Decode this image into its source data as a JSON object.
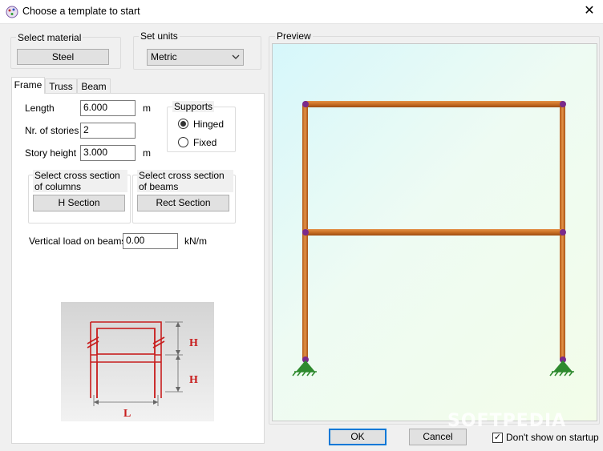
{
  "window": {
    "title": "Choose a template to start"
  },
  "material": {
    "label": "Select material",
    "button": "Steel"
  },
  "units": {
    "label": "Set units",
    "selected": "Metric"
  },
  "tabs": [
    {
      "label": "Frame",
      "active": true
    },
    {
      "label": "Truss",
      "active": false
    },
    {
      "label": "Beam",
      "active": false
    }
  ],
  "frame": {
    "length": {
      "label": "Length",
      "value": "6.000",
      "unit": "m"
    },
    "stories": {
      "label": "Nr. of stories",
      "value": "2"
    },
    "story_height": {
      "label": "Story height",
      "value": "3.000",
      "unit": "m"
    },
    "supports": {
      "label": "Supports",
      "options": [
        {
          "label": "Hinged",
          "selected": true
        },
        {
          "label": "Fixed",
          "selected": false
        }
      ]
    },
    "columns_section": {
      "label": "Select cross section of columns",
      "button": "H Section"
    },
    "beams_section": {
      "label": "Select cross section of beams",
      "button": "Rect Section"
    },
    "vertical_load": {
      "label": "Vertical load on beams",
      "value": "0.00",
      "unit": "kN/m"
    }
  },
  "diagram": {
    "dim_h1": "H",
    "dim_h2": "H",
    "dim_l": "L"
  },
  "preview": {
    "label": "Preview",
    "watermark": "SOFTPEDIA"
  },
  "footer": {
    "ok": "OK",
    "cancel": "Cancel",
    "dont_show": "Don't show on startup",
    "dont_show_checked": true
  },
  "colors": {
    "member": "#d07a2c",
    "node": "#7a2a8c",
    "support": "#2f8a2f"
  }
}
